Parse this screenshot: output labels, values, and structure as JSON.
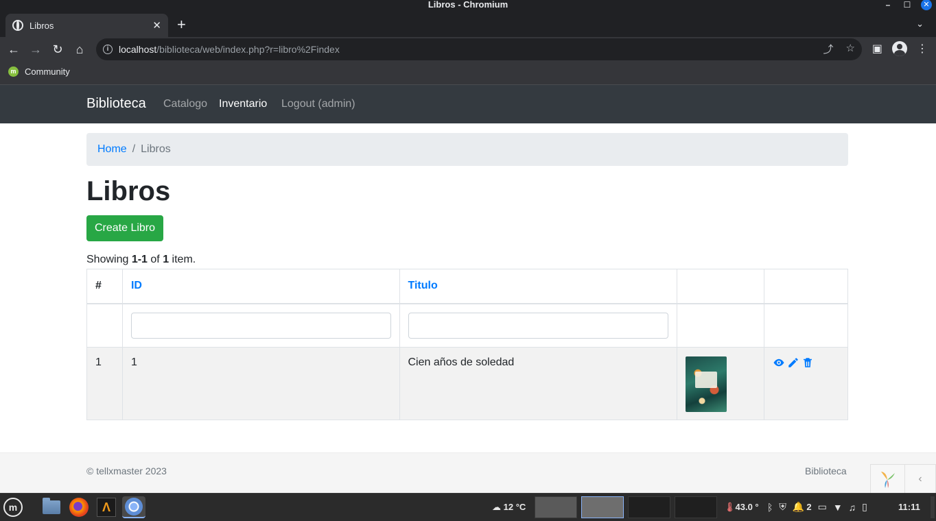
{
  "window": {
    "title": "Libros - Chromium"
  },
  "tab": {
    "title": "Libros"
  },
  "address": {
    "host": "localhost",
    "path": "/biblioteca/web/index.php?r=libro%2Findex"
  },
  "bookmarks": [
    {
      "label": "Community"
    }
  ],
  "navbar": {
    "brand": "Biblioteca",
    "links": [
      {
        "label": "Catalogo",
        "active": false
      },
      {
        "label": "Inventario",
        "active": true
      },
      {
        "label": "Logout (admin)",
        "active": false
      }
    ]
  },
  "breadcrumb": {
    "home": "Home",
    "separator": "/",
    "current": "Libros"
  },
  "page": {
    "title": "Libros",
    "create_button": "Create Libro",
    "summary": {
      "prefix": "Showing ",
      "range": "1-1",
      "of": " of ",
      "total": "1",
      "suffix": " item."
    }
  },
  "grid": {
    "headers": {
      "index": "#",
      "id": "ID",
      "titulo": "Titulo"
    },
    "rows": [
      {
        "index": "1",
        "id": "1",
        "titulo": "Cien años de soledad"
      }
    ]
  },
  "footer": {
    "copyright": "© tellxmaster 2023",
    "right": "Biblioteca"
  },
  "taskbar": {
    "weather": "12 °C",
    "temperature": "43.0 °",
    "notifications": "2",
    "clock": "11:11"
  },
  "colors": {
    "primary": "#007bff",
    "success": "#28a745",
    "navbar": "#343a40"
  }
}
